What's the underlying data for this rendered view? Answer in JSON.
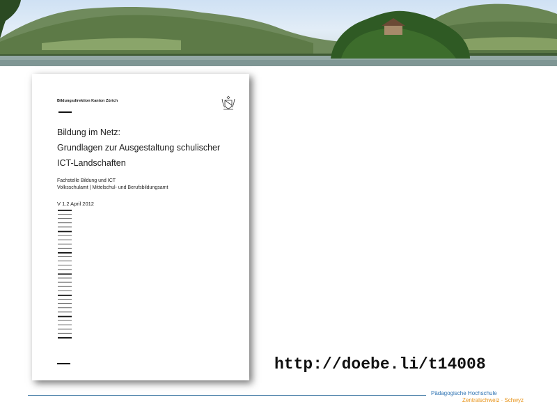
{
  "banner": {
    "alt": "Lake landscape with mountains and small wooded island"
  },
  "document": {
    "organization": "Bildungsdirektion Kanton Zürich",
    "title_lines": [
      "Bildung im Netz:",
      "Grundlagen zur Ausgestaltung schulischer",
      "ICT-Landschaften"
    ],
    "department_lines": [
      "Fachstelle Bildung und ICT",
      "Volksschulamt | Mittelschul- und Berufsbildungsamt"
    ],
    "version": "V 1.2 April 2012",
    "crest_icon": "zurich-crest-icon"
  },
  "url": "http://doebe.li/t14008",
  "footer": {
    "logo_line1": "Pädagogische Hochschule",
    "logo_line2": "Zentralschweiz · Schwyz",
    "colors": {
      "line": "#4a7fa8",
      "logo_blue": "#2e73b3",
      "logo_orange": "#e8941a"
    }
  }
}
